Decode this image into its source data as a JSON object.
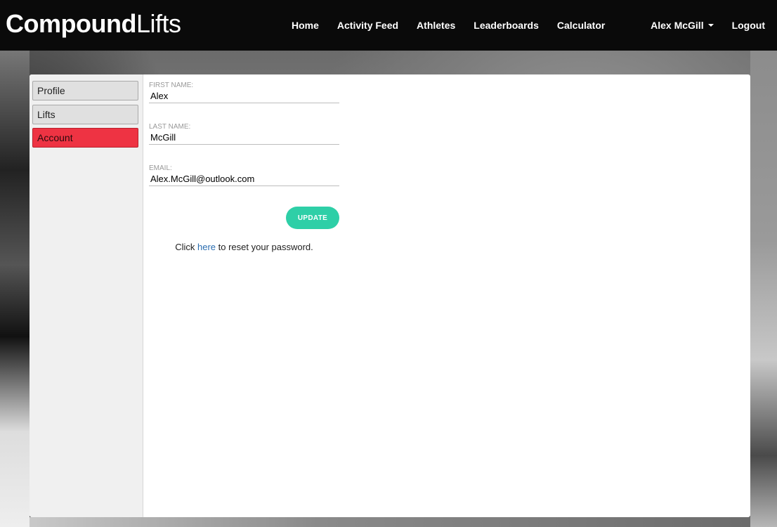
{
  "brand": {
    "name_bold": "Compound",
    "name_light": "Lifts"
  },
  "nav": {
    "links": [
      "Home",
      "Activity Feed",
      "Athletes",
      "Leaderboards",
      "Calculator"
    ],
    "user_name": "Alex McGill",
    "logout_label": "Logout"
  },
  "sidebar": {
    "items": [
      {
        "label": "Profile",
        "active": false
      },
      {
        "label": "Lifts",
        "active": false
      },
      {
        "label": "Account",
        "active": true
      }
    ]
  },
  "account_form": {
    "first_name": {
      "label": "FIRST NAME:",
      "value": "Alex"
    },
    "last_name": {
      "label": "LAST NAME:",
      "value": "McGill"
    },
    "email": {
      "label": "EMAIL:",
      "value": "Alex.McGill@outlook.com"
    },
    "update_label": "UPDATE",
    "reset_prefix": "Click ",
    "reset_link": "here",
    "reset_suffix": " to reset your password."
  },
  "colors": {
    "accent_active": "#ee3343",
    "update_button": "#2ecfa7",
    "link": "#2a6db0",
    "navbar": "#0a0a0a"
  }
}
